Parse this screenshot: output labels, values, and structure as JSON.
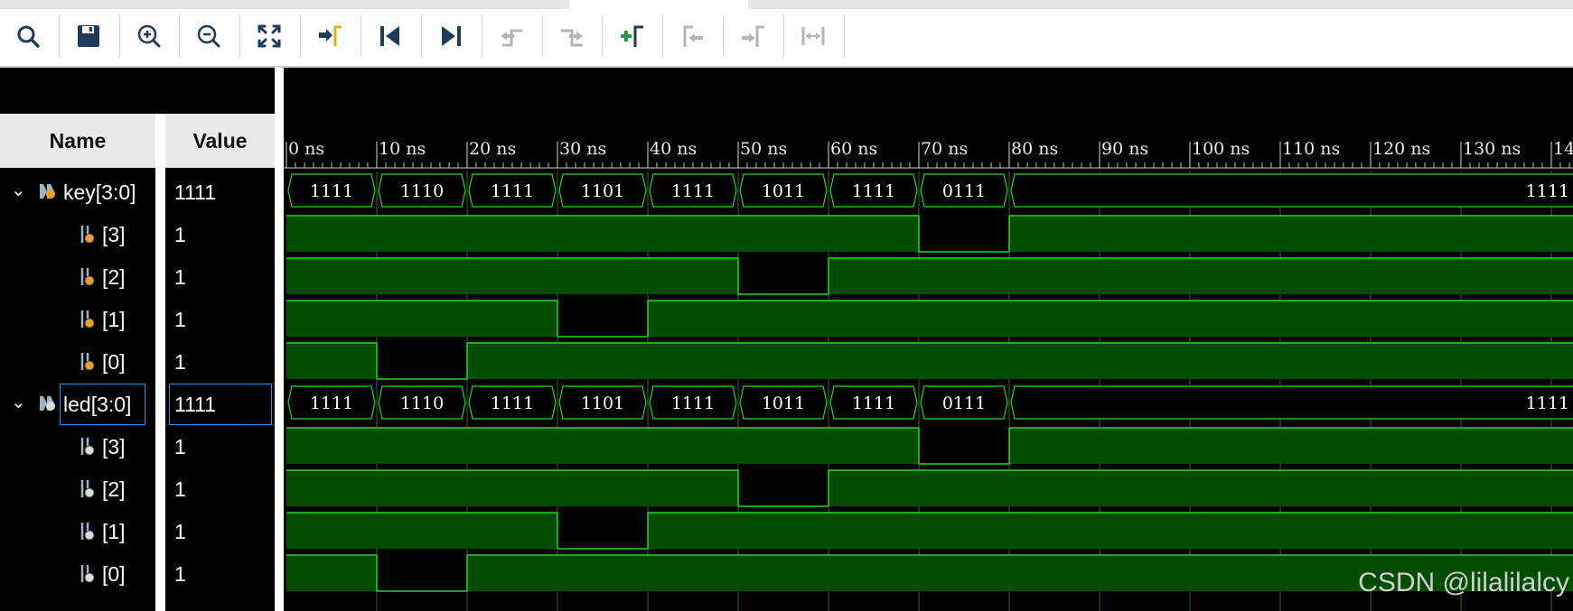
{
  "toolbar": {
    "buttons": [
      {
        "name": "search-icon",
        "enabled": true
      },
      {
        "name": "save-icon",
        "enabled": true
      },
      {
        "name": "zoom-in-icon",
        "enabled": true
      },
      {
        "name": "zoom-out-icon",
        "enabled": true
      },
      {
        "name": "zoom-fit-icon",
        "enabled": true
      },
      {
        "name": "go-to-cursor-icon",
        "enabled": true
      },
      {
        "name": "go-to-start-icon",
        "enabled": true
      },
      {
        "name": "go-to-end-icon",
        "enabled": true
      },
      {
        "name": "previous-transition-icon",
        "enabled": false
      },
      {
        "name": "next-transition-icon",
        "enabled": false
      },
      {
        "name": "add-marker-icon",
        "enabled": true
      },
      {
        "name": "previous-marker-icon",
        "enabled": false
      },
      {
        "name": "next-marker-icon",
        "enabled": false
      },
      {
        "name": "swap-cursors-icon",
        "enabled": false
      }
    ]
  },
  "headers": {
    "name": "Name",
    "value": "Value"
  },
  "signals": [
    {
      "name": "key[3:0]",
      "value": "1111",
      "type": "bus",
      "expanded": true,
      "kind": "input"
    },
    {
      "name": "[3]",
      "value": "1",
      "type": "bit",
      "kind": "input"
    },
    {
      "name": "[2]",
      "value": "1",
      "type": "bit",
      "kind": "input"
    },
    {
      "name": "[1]",
      "value": "1",
      "type": "bit",
      "kind": "input"
    },
    {
      "name": "[0]",
      "value": "1",
      "type": "bit",
      "kind": "input"
    },
    {
      "name": "led[3:0]",
      "value": "1111",
      "type": "bus",
      "expanded": true,
      "selected": true,
      "kind": "output"
    },
    {
      "name": "[3]",
      "value": "1",
      "type": "bit",
      "kind": "output"
    },
    {
      "name": "[2]",
      "value": "1",
      "type": "bit",
      "kind": "output"
    },
    {
      "name": "[1]",
      "value": "1",
      "type": "bit",
      "kind": "output"
    },
    {
      "name": "[0]",
      "value": "1",
      "type": "bit",
      "kind": "output"
    }
  ],
  "timeline": {
    "ticks": [
      "0 ns",
      "10 ns",
      "20 ns",
      "30 ns",
      "40 ns",
      "50 ns",
      "60 ns",
      "70 ns",
      "80 ns",
      "90 ns",
      "100 ns",
      "110 ns",
      "120 ns",
      "130 ns",
      "14"
    ],
    "step_ns": 10
  },
  "waves": {
    "segments": [
      "1111",
      "1110",
      "1111",
      "1101",
      "1111",
      "1011",
      "1111",
      "0111",
      "1111"
    ],
    "tail_label": "1111"
  },
  "colors": {
    "wave_fill": "#034d03",
    "wave_line": "#22d922",
    "accent": "#3f8be0"
  },
  "watermark": "CSDN @lilalilalcy"
}
